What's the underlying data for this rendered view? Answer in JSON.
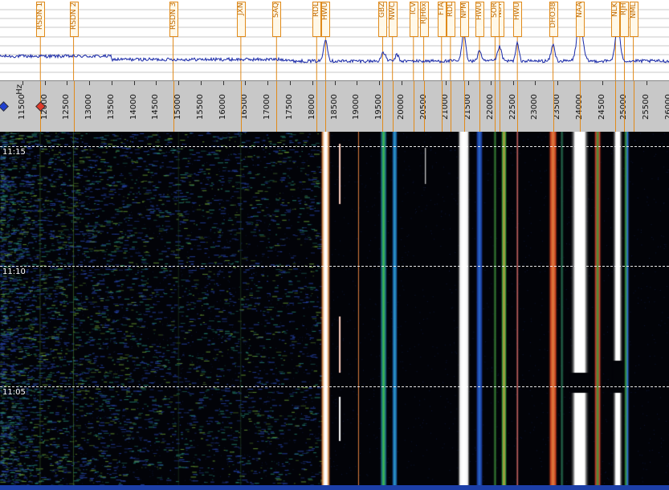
{
  "spectrum": {
    "freq_min": 11000,
    "freq_max": 26000,
    "stations": [
      {
        "label": "RSDN 1",
        "freq": 11905
      },
      {
        "label": "RSDN 2",
        "freq": 12649
      },
      {
        "label": "RSDN 3",
        "freq": 14881
      },
      {
        "label": "JXN",
        "freq": 16400
      },
      {
        "label": "SAQ",
        "freq": 17200
      },
      {
        "label": "RDL",
        "freq": 18100
      },
      {
        "label": "HWU",
        "freq": 18300
      },
      {
        "label": "GBZ",
        "freq": 19580
      },
      {
        "label": "NWC",
        "freq": 19800
      },
      {
        "label": "ICV",
        "freq": 20270
      },
      {
        "label": "RJH6x",
        "freq": 20500
      },
      {
        "label": "FTA",
        "freq": 20900
      },
      {
        "label": "RDL",
        "freq": 21100
      },
      {
        "label": "NPM",
        "freq": 21400
      },
      {
        "label": "HWU",
        "freq": 21750
      },
      {
        "label": "NDT",
        "freq": 22200
      },
      {
        "label": "SOR",
        "freq": 22100
      },
      {
        "label": "HWU",
        "freq": 22600
      },
      {
        "label": "DHO38",
        "freq": 23400
      },
      {
        "label": "NAA",
        "freq": 24000
      },
      {
        "label": "NLK",
        "freq": 24800
      },
      {
        "label": "RJH",
        "freq": 25000
      },
      {
        "label": "NML",
        "freq": 25200
      }
    ]
  },
  "axis": {
    "unit": "Hz",
    "ticks": [
      "11500",
      "12000",
      "12500",
      "13000",
      "13500",
      "14000",
      "14500",
      "15000",
      "15500",
      "16000",
      "16500",
      "17000",
      "17500",
      "18000",
      "18500",
      "19000",
      "19500",
      "20000",
      "20500",
      "21000",
      "21500",
      "22000",
      "22500",
      "23000",
      "23500",
      "24000",
      "24500",
      "25000",
      "25500",
      "26000"
    ],
    "markers": [
      {
        "name": "left-marker",
        "color": "#1f3fd0",
        "freq": 11000
      },
      {
        "name": "right-marker",
        "color": "#e03a2a",
        "freq": 11905
      }
    ]
  },
  "waterfall": {
    "time_labels": [
      {
        "label": "11:15",
        "frac": 0.04
      },
      {
        "label": "11:10",
        "frac": 0.38
      },
      {
        "label": "11:05",
        "frac": 0.72
      }
    ]
  }
}
